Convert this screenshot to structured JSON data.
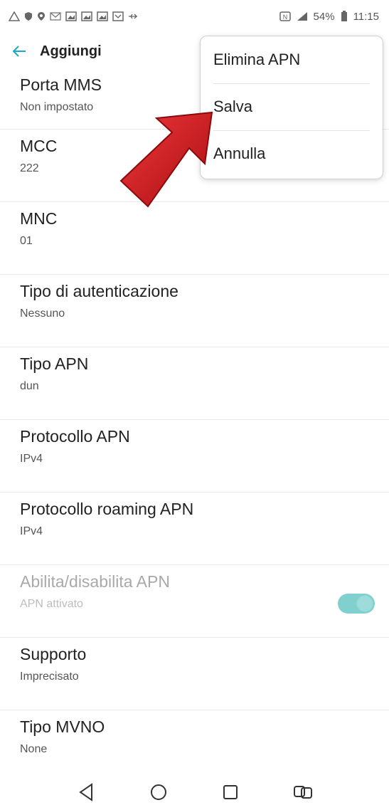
{
  "status_bar": {
    "left_icons": [
      "warning-icon",
      "shield-icon",
      "location-icon",
      "mail-icon",
      "gallery-icon",
      "gallery-icon",
      "gallery-icon",
      "screen-icon",
      "usb-icon"
    ],
    "right": {
      "nfc_sim": "N",
      "battery_text": "54%",
      "time": "11:15"
    }
  },
  "app_bar": {
    "title": "Aggiungi"
  },
  "settings": [
    {
      "title": "Porta MMS",
      "value": "Non impostato"
    },
    {
      "title": "MCC",
      "value": "222"
    },
    {
      "title": "MNC",
      "value": "01"
    },
    {
      "title": "Tipo di autenticazione",
      "value": "Nessuno"
    },
    {
      "title": "Tipo APN",
      "value": "dun"
    },
    {
      "title": "Protocollo APN",
      "value": "IPv4"
    },
    {
      "title": "Protocollo roaming APN",
      "value": "IPv4"
    },
    {
      "title": "Abilita/disabilita APN",
      "value": "APN attivato",
      "toggle": true,
      "enabled": false
    },
    {
      "title": "Supporto",
      "value": "Imprecisato"
    },
    {
      "title": "Tipo MVNO",
      "value": "None"
    }
  ],
  "menu": {
    "items": [
      "Elimina APN",
      "Salva",
      "Annulla"
    ]
  },
  "colors": {
    "accent": "#1aa9c9",
    "toggle_track": "#7fd0cf",
    "arrow_red": "#d0151b"
  },
  "nav_bar": [
    "back-icon",
    "home-icon",
    "recents-icon",
    "dual-window-icon"
  ]
}
